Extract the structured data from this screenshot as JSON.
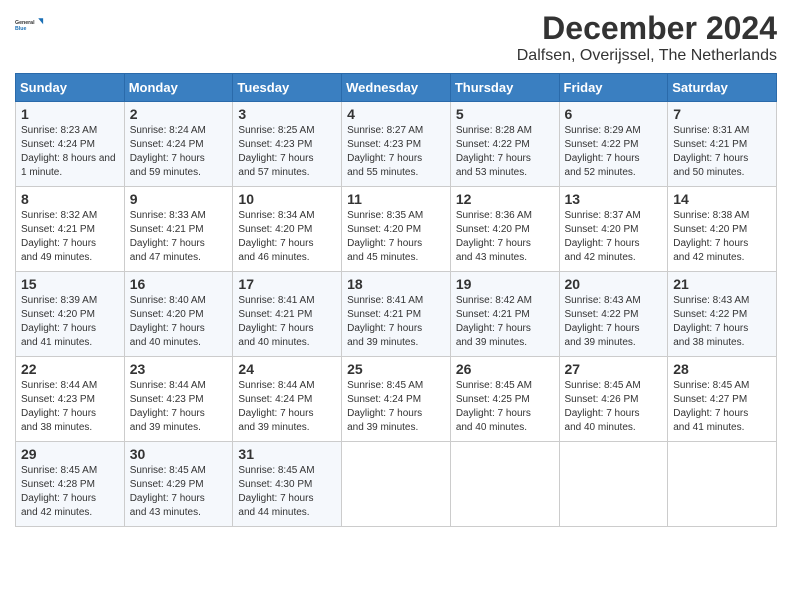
{
  "header": {
    "logo_line1": "General",
    "logo_line2": "Blue",
    "month": "December 2024",
    "location": "Dalfsen, Overijssel, The Netherlands"
  },
  "weekdays": [
    "Sunday",
    "Monday",
    "Tuesday",
    "Wednesday",
    "Thursday",
    "Friday",
    "Saturday"
  ],
  "weeks": [
    [
      {
        "day": 1,
        "sunrise": "8:23 AM",
        "sunset": "4:24 PM",
        "daylight": "8 hours and 1 minute."
      },
      {
        "day": 2,
        "sunrise": "8:24 AM",
        "sunset": "4:24 PM",
        "daylight": "7 hours and 59 minutes."
      },
      {
        "day": 3,
        "sunrise": "8:25 AM",
        "sunset": "4:23 PM",
        "daylight": "7 hours and 57 minutes."
      },
      {
        "day": 4,
        "sunrise": "8:27 AM",
        "sunset": "4:23 PM",
        "daylight": "7 hours and 55 minutes."
      },
      {
        "day": 5,
        "sunrise": "8:28 AM",
        "sunset": "4:22 PM",
        "daylight": "7 hours and 53 minutes."
      },
      {
        "day": 6,
        "sunrise": "8:29 AM",
        "sunset": "4:22 PM",
        "daylight": "7 hours and 52 minutes."
      },
      {
        "day": 7,
        "sunrise": "8:31 AM",
        "sunset": "4:21 PM",
        "daylight": "7 hours and 50 minutes."
      }
    ],
    [
      {
        "day": 8,
        "sunrise": "8:32 AM",
        "sunset": "4:21 PM",
        "daylight": "7 hours and 49 minutes."
      },
      {
        "day": 9,
        "sunrise": "8:33 AM",
        "sunset": "4:21 PM",
        "daylight": "7 hours and 47 minutes."
      },
      {
        "day": 10,
        "sunrise": "8:34 AM",
        "sunset": "4:20 PM",
        "daylight": "7 hours and 46 minutes."
      },
      {
        "day": 11,
        "sunrise": "8:35 AM",
        "sunset": "4:20 PM",
        "daylight": "7 hours and 45 minutes."
      },
      {
        "day": 12,
        "sunrise": "8:36 AM",
        "sunset": "4:20 PM",
        "daylight": "7 hours and 43 minutes."
      },
      {
        "day": 13,
        "sunrise": "8:37 AM",
        "sunset": "4:20 PM",
        "daylight": "7 hours and 42 minutes."
      },
      {
        "day": 14,
        "sunrise": "8:38 AM",
        "sunset": "4:20 PM",
        "daylight": "7 hours and 42 minutes."
      }
    ],
    [
      {
        "day": 15,
        "sunrise": "8:39 AM",
        "sunset": "4:20 PM",
        "daylight": "7 hours and 41 minutes."
      },
      {
        "day": 16,
        "sunrise": "8:40 AM",
        "sunset": "4:20 PM",
        "daylight": "7 hours and 40 minutes."
      },
      {
        "day": 17,
        "sunrise": "8:41 AM",
        "sunset": "4:21 PM",
        "daylight": "7 hours and 40 minutes."
      },
      {
        "day": 18,
        "sunrise": "8:41 AM",
        "sunset": "4:21 PM",
        "daylight": "7 hours and 39 minutes."
      },
      {
        "day": 19,
        "sunrise": "8:42 AM",
        "sunset": "4:21 PM",
        "daylight": "7 hours and 39 minutes."
      },
      {
        "day": 20,
        "sunrise": "8:43 AM",
        "sunset": "4:22 PM",
        "daylight": "7 hours and 39 minutes."
      },
      {
        "day": 21,
        "sunrise": "8:43 AM",
        "sunset": "4:22 PM",
        "daylight": "7 hours and 38 minutes."
      }
    ],
    [
      {
        "day": 22,
        "sunrise": "8:44 AM",
        "sunset": "4:23 PM",
        "daylight": "7 hours and 38 minutes."
      },
      {
        "day": 23,
        "sunrise": "8:44 AM",
        "sunset": "4:23 PM",
        "daylight": "7 hours and 39 minutes."
      },
      {
        "day": 24,
        "sunrise": "8:44 AM",
        "sunset": "4:24 PM",
        "daylight": "7 hours and 39 minutes."
      },
      {
        "day": 25,
        "sunrise": "8:45 AM",
        "sunset": "4:24 PM",
        "daylight": "7 hours and 39 minutes."
      },
      {
        "day": 26,
        "sunrise": "8:45 AM",
        "sunset": "4:25 PM",
        "daylight": "7 hours and 40 minutes."
      },
      {
        "day": 27,
        "sunrise": "8:45 AM",
        "sunset": "4:26 PM",
        "daylight": "7 hours and 40 minutes."
      },
      {
        "day": 28,
        "sunrise": "8:45 AM",
        "sunset": "4:27 PM",
        "daylight": "7 hours and 41 minutes."
      }
    ],
    [
      {
        "day": 29,
        "sunrise": "8:45 AM",
        "sunset": "4:28 PM",
        "daylight": "7 hours and 42 minutes."
      },
      {
        "day": 30,
        "sunrise": "8:45 AM",
        "sunset": "4:29 PM",
        "daylight": "7 hours and 43 minutes."
      },
      {
        "day": 31,
        "sunrise": "8:45 AM",
        "sunset": "4:30 PM",
        "daylight": "7 hours and 44 minutes."
      },
      null,
      null,
      null,
      null
    ]
  ]
}
